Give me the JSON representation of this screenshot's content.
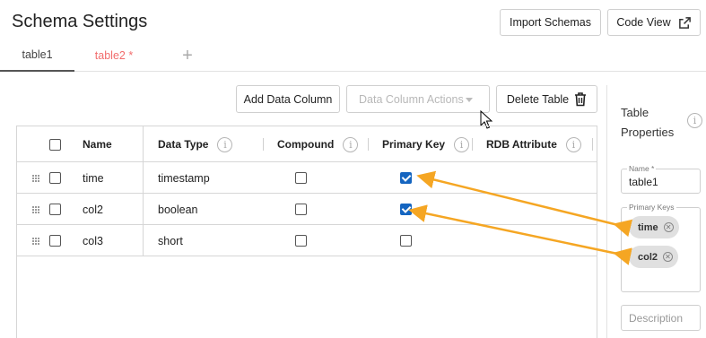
{
  "header": {
    "title": "Schema Settings",
    "import_label": "Import Schemas",
    "code_view_label": "Code View"
  },
  "tabs": [
    {
      "label": "table1",
      "active": true
    },
    {
      "label": "table2 *",
      "modified": true
    }
  ],
  "actions": {
    "add_column": "Add Data Column",
    "column_actions": "Data Column Actions",
    "delete_table": "Delete Table"
  },
  "grid": {
    "columns": [
      "Name",
      "Data Type",
      "Compound",
      "Primary Key",
      "RDB Attribute"
    ],
    "rows": [
      {
        "name": "time",
        "type": "timestamp",
        "compound": false,
        "primary_key": true
      },
      {
        "name": "col2",
        "type": "boolean",
        "compound": false,
        "primary_key": true
      },
      {
        "name": "col3",
        "type": "short",
        "compound": false,
        "primary_key": false
      }
    ]
  },
  "side": {
    "title": "Table Properties",
    "name_legend": "Name *",
    "name_value": "table1",
    "pk_legend": "Primary Keys",
    "primary_keys": [
      "time",
      "col2"
    ],
    "description_placeholder": "Description"
  },
  "colors": {
    "accent": "#1565c0",
    "modified_tab": "#f26d6d",
    "annotation_arrow": "#f5a623"
  }
}
